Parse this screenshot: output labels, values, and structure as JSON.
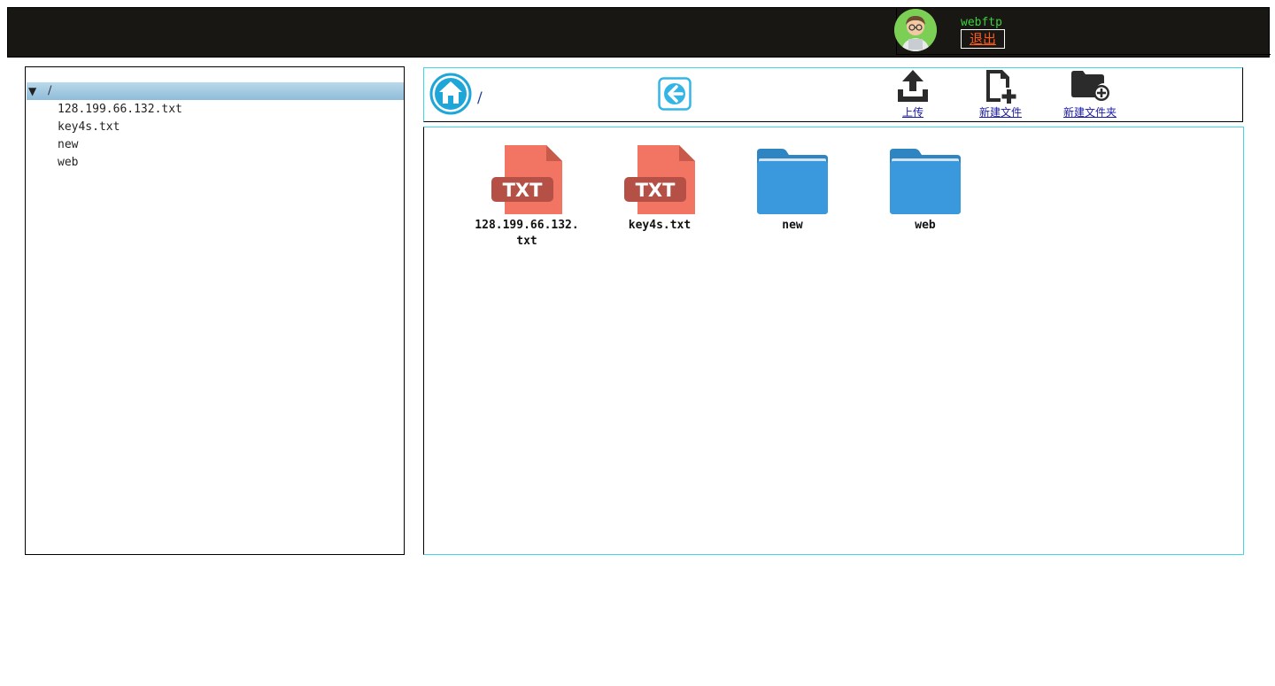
{
  "header": {
    "username": "webftp",
    "logout_label": "退出"
  },
  "tree": {
    "root_label": "/",
    "items": [
      {
        "label": "128.199.66.132.txt"
      },
      {
        "label": "key4s.txt"
      },
      {
        "label": "new"
      },
      {
        "label": "web"
      }
    ]
  },
  "toolbar": {
    "current_path": "/",
    "upload_label": "上传",
    "new_file_label": "新建文件",
    "new_folder_label": "新建文件夹"
  },
  "files": [
    {
      "name": "128.199.66.132.txt",
      "type": "txt",
      "badge": "TXT"
    },
    {
      "name": "key4s.txt",
      "type": "txt",
      "badge": "TXT"
    },
    {
      "name": "new",
      "type": "folder"
    },
    {
      "name": "web",
      "type": "folder"
    }
  ],
  "colors": {
    "header_bg": "#181714",
    "username": "#3bd23b",
    "logout": "#ff5a1e",
    "txt_icon": "#f27462",
    "txt_badge": "#b55047",
    "folder": "#3a99dc",
    "accent": "#1fa6d8"
  },
  "icons": {
    "home": "home-icon",
    "back": "back-arrow-icon",
    "upload": "upload-icon",
    "new_file": "new-file-icon",
    "new_folder": "new-folder-icon"
  }
}
